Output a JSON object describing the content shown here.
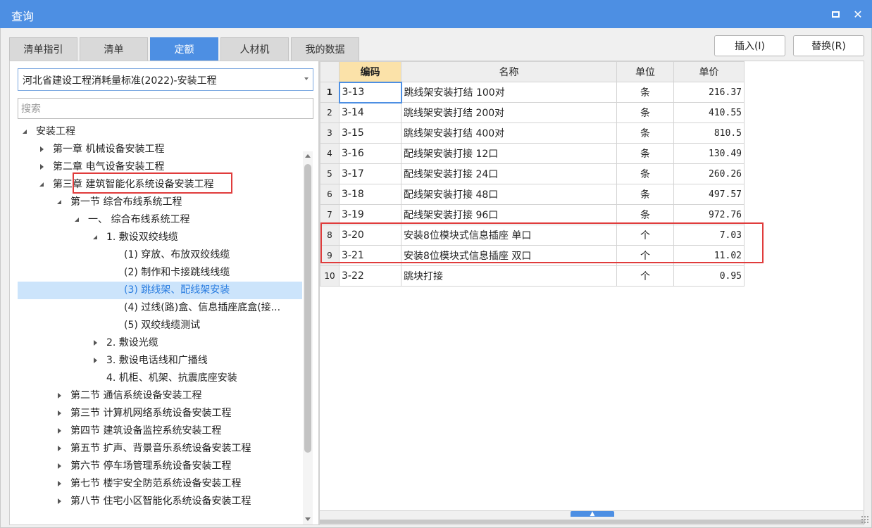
{
  "window": {
    "title": "查询"
  },
  "tabs": [
    {
      "label": "清单指引",
      "active": false
    },
    {
      "label": "清单",
      "active": false
    },
    {
      "label": "定额",
      "active": true
    },
    {
      "label": "人材机",
      "active": false
    },
    {
      "label": "我的数据",
      "active": false
    }
  ],
  "buttons": {
    "insert": "插入(I)",
    "replace": "替换(R)"
  },
  "standard_select": {
    "value": "河北省建设工程消耗量标准(2022)-安装工程"
  },
  "search": {
    "placeholder": "搜索"
  },
  "tree": [
    {
      "label": "安装工程",
      "level": 0,
      "state": "expanded"
    },
    {
      "label": "第一章 机械设备安装工程",
      "level": 1,
      "state": "collapsed"
    },
    {
      "label": "第二章 电气设备安装工程",
      "level": 1,
      "state": "collapsed"
    },
    {
      "label": "第三章 建筑智能化系统设备安装工程",
      "level": 1,
      "state": "expanded"
    },
    {
      "label": "第一节 综合布线系统工程",
      "level": 2,
      "state": "expanded"
    },
    {
      "label": "一、 综合布线系统工程",
      "level": 3,
      "state": "expanded"
    },
    {
      "label": "1. 敷设双绞线缆",
      "level": 4,
      "state": "expanded"
    },
    {
      "label": "(1) 穿放、布放双绞线缆",
      "level": 5,
      "state": "leaf"
    },
    {
      "label": "(2) 制作和卡接跳线线缆",
      "level": 5,
      "state": "leaf"
    },
    {
      "label": "(3) 跳线架、配线架安装",
      "level": 5,
      "state": "leaf",
      "selected": true
    },
    {
      "label": "(4) 过线(路)盒、信息插座底盒(接...",
      "level": 5,
      "state": "leaf"
    },
    {
      "label": "(5) 双绞线缆测试",
      "level": 5,
      "state": "leaf"
    },
    {
      "label": "2. 敷设光缆",
      "level": 4,
      "state": "collapsed"
    },
    {
      "label": "3. 敷设电话线和广播线",
      "level": 4,
      "state": "collapsed"
    },
    {
      "label": "4. 机柜、机架、抗震底座安装",
      "level": 4,
      "state": "leaf"
    },
    {
      "label": "第二节 通信系统设备安装工程",
      "level": 2,
      "state": "collapsed"
    },
    {
      "label": "第三节 计算机网络系统设备安装工程",
      "level": 2,
      "state": "collapsed"
    },
    {
      "label": "第四节 建筑设备监控系统安装工程",
      "level": 2,
      "state": "collapsed"
    },
    {
      "label": "第五节 扩声、背景音乐系统设备安装工程",
      "level": 2,
      "state": "collapsed"
    },
    {
      "label": "第六节 停车场管理系统设备安装工程",
      "level": 2,
      "state": "collapsed"
    },
    {
      "label": "第七节 楼宇安全防范系统设备安装工程",
      "level": 2,
      "state": "collapsed"
    },
    {
      "label": "第八节 住宅小区智能化系统设备安装工程",
      "level": 2,
      "state": "collapsed"
    }
  ],
  "table": {
    "headers": {
      "code": "编码",
      "name": "名称",
      "unit": "单位",
      "price": "单价"
    },
    "rows": [
      {
        "num": "1",
        "code": "3-13",
        "name": "跳线架安装打结 100对",
        "unit": "条",
        "price": "216.37"
      },
      {
        "num": "2",
        "code": "3-14",
        "name": "跳线架安装打结 200对",
        "unit": "条",
        "price": "410.55"
      },
      {
        "num": "3",
        "code": "3-15",
        "name": "跳线架安装打结 400对",
        "unit": "条",
        "price": "810.5"
      },
      {
        "num": "4",
        "code": "3-16",
        "name": "配线架安装打接 12口",
        "unit": "条",
        "price": "130.49"
      },
      {
        "num": "5",
        "code": "3-17",
        "name": "配线架安装打接 24口",
        "unit": "条",
        "price": "260.26"
      },
      {
        "num": "6",
        "code": "3-18",
        "name": "配线架安装打接 48口",
        "unit": "条",
        "price": "497.57"
      },
      {
        "num": "7",
        "code": "3-19",
        "name": "配线架安装打接 96口",
        "unit": "条",
        "price": "972.76"
      },
      {
        "num": "8",
        "code": "3-20",
        "name": "安装8位模块式信息插座 单口",
        "unit": "个",
        "price": "7.03"
      },
      {
        "num": "9",
        "code": "3-21",
        "name": "安装8位模块式信息插座 双口",
        "unit": "个",
        "price": "11.02"
      },
      {
        "num": "10",
        "code": "3-22",
        "name": "跳块打接",
        "unit": "个",
        "price": "0.95"
      }
    ]
  },
  "colors": {
    "accent": "#4d8fe3",
    "highlight_box": "#e03c3c",
    "selected_bg": "#cce4fb",
    "sorted_header": "#fbe2a9"
  }
}
